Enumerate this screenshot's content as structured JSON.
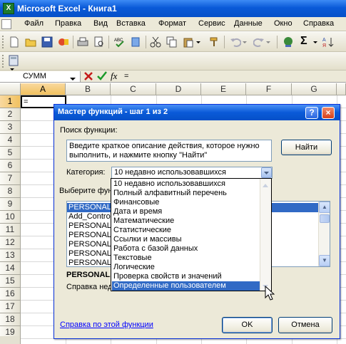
{
  "window": {
    "title": "Microsoft Excel - Книга1",
    "app_icon": "X"
  },
  "menu": [
    "Файл",
    "Правка",
    "Вид",
    "Вставка",
    "Формат",
    "Сервис",
    "Данные",
    "Окно",
    "Справка"
  ],
  "formula_bar": {
    "name_box": "СУММ",
    "fx_label": "fx",
    "content": "="
  },
  "columns": [
    "A",
    "B",
    "C",
    "D",
    "E",
    "F",
    "G"
  ],
  "rows": [
    "1",
    "2",
    "3",
    "4",
    "5",
    "6",
    "7",
    "8",
    "9",
    "10",
    "11",
    "12",
    "13",
    "14",
    "15",
    "16",
    "17",
    "18",
    "19"
  ],
  "cells": {
    "A1": "="
  },
  "dialog": {
    "title": "Мастер функций - шаг 1 из 2",
    "help_button": "?",
    "close_button": "×",
    "search_label": "Поиск функции:",
    "search_text": "Введите краткое описание действия, которое нужно выполнить, и нажмите кнопку \"Найти\"",
    "find_button": "Найти",
    "category_label": "Категория:",
    "category_value": "10 недавно использовавшихся",
    "select_function_label": "Выберите фун",
    "function_list": [
      "PERSONAL.",
      "Add_Contro",
      "PERSONAL.",
      "PERSONAL.",
      "PERSONAL.",
      "PERSONAL.",
      "PERSONAL."
    ],
    "selected_function": "PERSONAL.",
    "description_label": "Справка нед",
    "category_options": [
      "10 недавно использовавшихся",
      "Полный алфавитный перечень",
      "Финансовые",
      "Дата и время",
      "Математические",
      "Статистические",
      "Ссылки и массивы",
      "Работа с базой данных",
      "Текстовые",
      "Логические",
      "Проверка свойств и значений",
      "Определенные пользователем"
    ],
    "highlighted_option": "Определенные пользователем",
    "help_link": "Справка по этой функции",
    "ok_button": "OK",
    "cancel_button": "Отмена"
  },
  "colors": {
    "title_blue": "#0a5ad8",
    "dialog_face": "#ece9d8",
    "highlight": "#316ac5"
  }
}
